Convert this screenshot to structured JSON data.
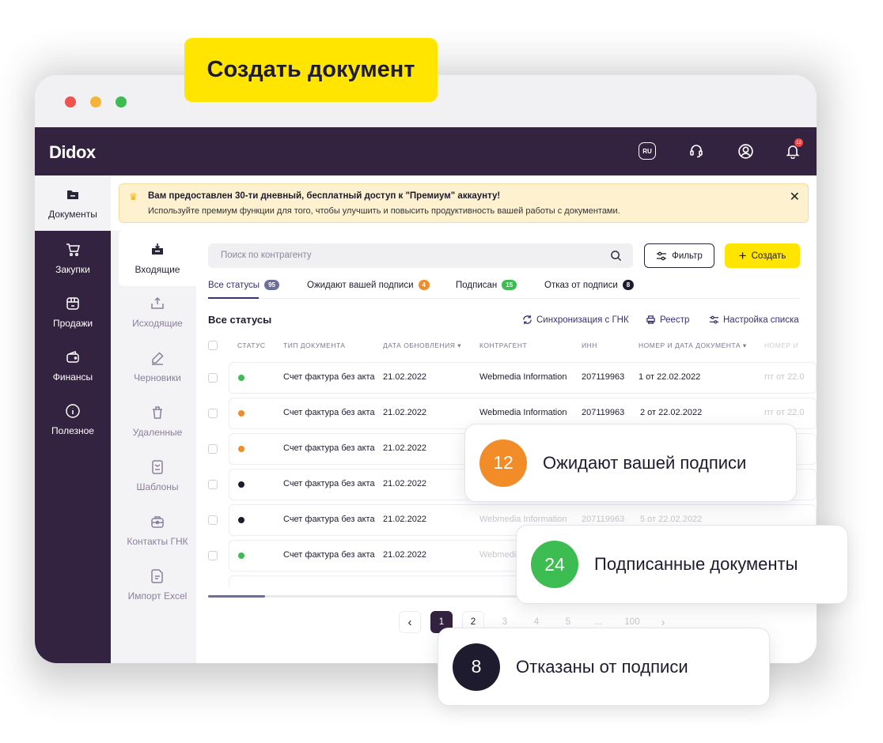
{
  "callout_create": "Создать документ",
  "brand": {
    "logo": "Didox",
    "lang": "RU",
    "notif_count": "12"
  },
  "leftnav": [
    {
      "label": "Документы",
      "icon": "folder-icon"
    },
    {
      "label": "Закупки",
      "icon": "cart-icon"
    },
    {
      "label": "Продажи",
      "icon": "shop-icon"
    },
    {
      "label": "Финансы",
      "icon": "wallet-icon"
    },
    {
      "label": "Полезное",
      "icon": "info-icon"
    }
  ],
  "banner": {
    "title": "Вам предоставлен 30-ти дневный, бесплатный доступ к \"Премиум\" аккаунту!",
    "text": "Используйте премиум функции для того, чтобы улучшить и повысить продуктивность вашей работы с документами."
  },
  "subnav": [
    {
      "label": "Входящие",
      "icon": "inbox-icon"
    },
    {
      "label": "Исходящие",
      "icon": "outbox-icon"
    },
    {
      "label": "Черновики",
      "icon": "pencil-icon"
    },
    {
      "label": "Удаленные",
      "icon": "trash-icon"
    },
    {
      "label": "Шаблоны",
      "icon": "template-icon"
    },
    {
      "label": "Контакты ГНК",
      "icon": "contacts-icon"
    },
    {
      "label": "Импорт Excel",
      "icon": "excel-icon"
    }
  ],
  "search": {
    "placeholder": "Поиск по контрагенту"
  },
  "toolbar": {
    "filter": "Фильтр",
    "create": "Создать"
  },
  "tabs": [
    {
      "label": "Все статусы",
      "count": "95",
      "color": "#6b6f9a"
    },
    {
      "label": "Ожидают вашей подписи",
      "count": "4",
      "color": "#f28c28"
    },
    {
      "label": "Подписан",
      "count": "15",
      "color": "#3dbc52"
    },
    {
      "label": "Отказ от подписи",
      "count": "8",
      "color": "#1e1b2e"
    }
  ],
  "section": {
    "title": "Все статусы",
    "sync": "Синхронизация с ГНК",
    "registry": "Реестр",
    "settings": "Настройка списка"
  },
  "columns": [
    "СТАТУС",
    "ТИП ДОКУМЕНТА",
    "ДАТА ОБНОВЛЕНИЯ ▾",
    "КОНТРАГЕНТ",
    "ИНН",
    "НОМЕР И ДАТА ДОКУМЕНТА ▾",
    "НОМЕР И"
  ],
  "rows": [
    {
      "status_color": "#3dbc52",
      "type": "Счет фактура без акта",
      "date": "21.02.2022",
      "counterparty": "Webmedia Information",
      "inn": "207119963",
      "number": "1 от 22.02.2022",
      "number2": "ггг от 22.0"
    },
    {
      "status_color": "#f28c28",
      "type": "Счет фактура без акта",
      "date": "21.02.2022",
      "counterparty": "Webmedia Information",
      "inn": "207119963",
      "number": "2 от 22.02.2022",
      "number2": "ггг от 22.0"
    },
    {
      "status_color": "#f28c28",
      "type": "Счет фактура без акта",
      "date": "21.02.2022"
    },
    {
      "status_color": "#1e1b2e",
      "type": "Счет фактура без акта",
      "date": "21.02.2022"
    },
    {
      "status_color": "#1e1b2e",
      "type": "Счет фактура без акта",
      "date": "21.02.2022",
      "counterparty": "Webmedia Information",
      "inn": "207119963",
      "number": "5 от 22.02.2022"
    },
    {
      "status_color": "#3dbc52",
      "type": "Счет фактура без акта",
      "date": "21.02.2022",
      "counterparty": "Webmedi"
    }
  ],
  "pagination": {
    "pages": [
      "1",
      "2",
      "3",
      "4",
      "5",
      "...",
      "100"
    ],
    "current": "1"
  },
  "cards": [
    {
      "count": "12",
      "label": "Ожидают вашей подписи",
      "color": "#f28c28"
    },
    {
      "count": "24",
      "label": "Подписанные документы",
      "color": "#3dbc52"
    },
    {
      "count": "8",
      "label": "Отказаны от подписи",
      "color": "#1e1b2e"
    }
  ]
}
